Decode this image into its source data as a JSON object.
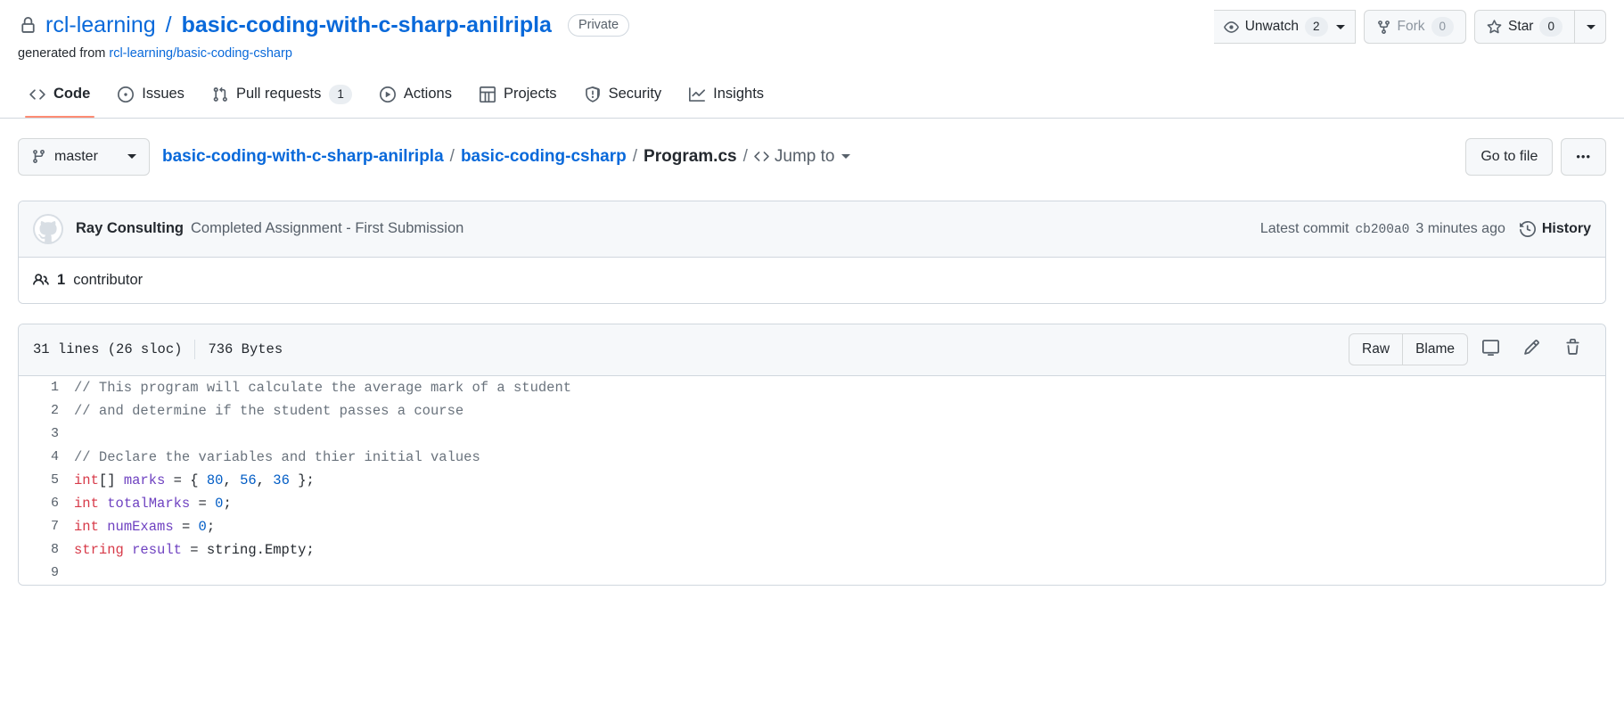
{
  "repo": {
    "visibility_icon": "lock-icon",
    "owner": "rcl-learning",
    "separator": "/",
    "name": "basic-coding-with-c-sharp-anilripla",
    "private_badge": "Private",
    "generated_from_label": "generated from",
    "generated_from_repo": "rcl-learning/basic-coding-csharp"
  },
  "header_actions": {
    "watch": {
      "label": "Unwatch",
      "count": "2",
      "icon": "eye-icon"
    },
    "fork": {
      "label": "Fork",
      "count": "0",
      "icon": "fork-icon"
    },
    "star": {
      "label": "Star",
      "count": "0",
      "icon": "star-icon"
    }
  },
  "nav": {
    "tabs": [
      {
        "label": "Code",
        "icon": "code-icon",
        "count": "",
        "active": true
      },
      {
        "label": "Issues",
        "icon": "issue-opened-icon",
        "count": "",
        "active": false
      },
      {
        "label": "Pull requests",
        "icon": "git-pull-request-icon",
        "count": "1",
        "active": false
      },
      {
        "label": "Actions",
        "icon": "play-icon",
        "count": "",
        "active": false
      },
      {
        "label": "Projects",
        "icon": "table-icon",
        "count": "",
        "active": false
      },
      {
        "label": "Security",
        "icon": "shield-icon",
        "count": "",
        "active": false
      },
      {
        "label": "Insights",
        "icon": "graph-icon",
        "count": "",
        "active": false
      }
    ]
  },
  "file_nav": {
    "branch": "master",
    "breadcrumb": {
      "repo": "basic-coding-with-c-sharp-anilripla",
      "folder": "basic-coding-csharp",
      "file": "Program.cs",
      "separator": "/"
    },
    "jump_to": "Jump to",
    "go_to_file": "Go to file",
    "overflow": "•••"
  },
  "commit": {
    "author": "Ray Consulting",
    "message": "Completed Assignment - First Submission",
    "latest_commit_label": "Latest commit",
    "sha": "cb200a0",
    "time": "3 minutes ago",
    "history_label": "History"
  },
  "contributors": {
    "count": "1",
    "label": "contributor"
  },
  "file": {
    "lines": "31 lines (26 sloc)",
    "size": "736 Bytes",
    "raw": "Raw",
    "blame": "Blame",
    "icons": [
      "desktop-download-icon",
      "pencil-icon",
      "trash-icon"
    ]
  },
  "code_lines": [
    {
      "n": "1",
      "tokens": [
        {
          "t": "// This program will calculate the average mark of a student",
          "c": "c-com"
        }
      ]
    },
    {
      "n": "2",
      "tokens": [
        {
          "t": "// and determine if the student passes a course",
          "c": "c-com"
        }
      ]
    },
    {
      "n": "3",
      "tokens": []
    },
    {
      "n": "4",
      "tokens": [
        {
          "t": "// Declare the variables and thier initial values",
          "c": "c-com"
        }
      ]
    },
    {
      "n": "5",
      "tokens": [
        {
          "t": "int",
          "c": "c-key"
        },
        {
          "t": "[] ",
          "c": ""
        },
        {
          "t": "marks",
          "c": "c-id"
        },
        {
          "t": " = { ",
          "c": ""
        },
        {
          "t": "80",
          "c": "c-num"
        },
        {
          "t": ", ",
          "c": ""
        },
        {
          "t": "56",
          "c": "c-num"
        },
        {
          "t": ", ",
          "c": ""
        },
        {
          "t": "36",
          "c": "c-num"
        },
        {
          "t": " };",
          "c": ""
        }
      ]
    },
    {
      "n": "6",
      "tokens": [
        {
          "t": "int",
          "c": "c-key"
        },
        {
          "t": " ",
          "c": ""
        },
        {
          "t": "totalMarks",
          "c": "c-id"
        },
        {
          "t": " = ",
          "c": ""
        },
        {
          "t": "0",
          "c": "c-num"
        },
        {
          "t": ";",
          "c": ""
        }
      ]
    },
    {
      "n": "7",
      "tokens": [
        {
          "t": "int",
          "c": "c-key"
        },
        {
          "t": " ",
          "c": ""
        },
        {
          "t": "numExams",
          "c": "c-id"
        },
        {
          "t": " = ",
          "c": ""
        },
        {
          "t": "0",
          "c": "c-num"
        },
        {
          "t": ";",
          "c": ""
        }
      ]
    },
    {
      "n": "8",
      "tokens": [
        {
          "t": "string",
          "c": "c-key"
        },
        {
          "t": " ",
          "c": ""
        },
        {
          "t": "result",
          "c": "c-id"
        },
        {
          "t": " = ",
          "c": ""
        },
        {
          "t": "string.Empty;",
          "c": ""
        }
      ]
    },
    {
      "n": "9",
      "tokens": []
    }
  ]
}
